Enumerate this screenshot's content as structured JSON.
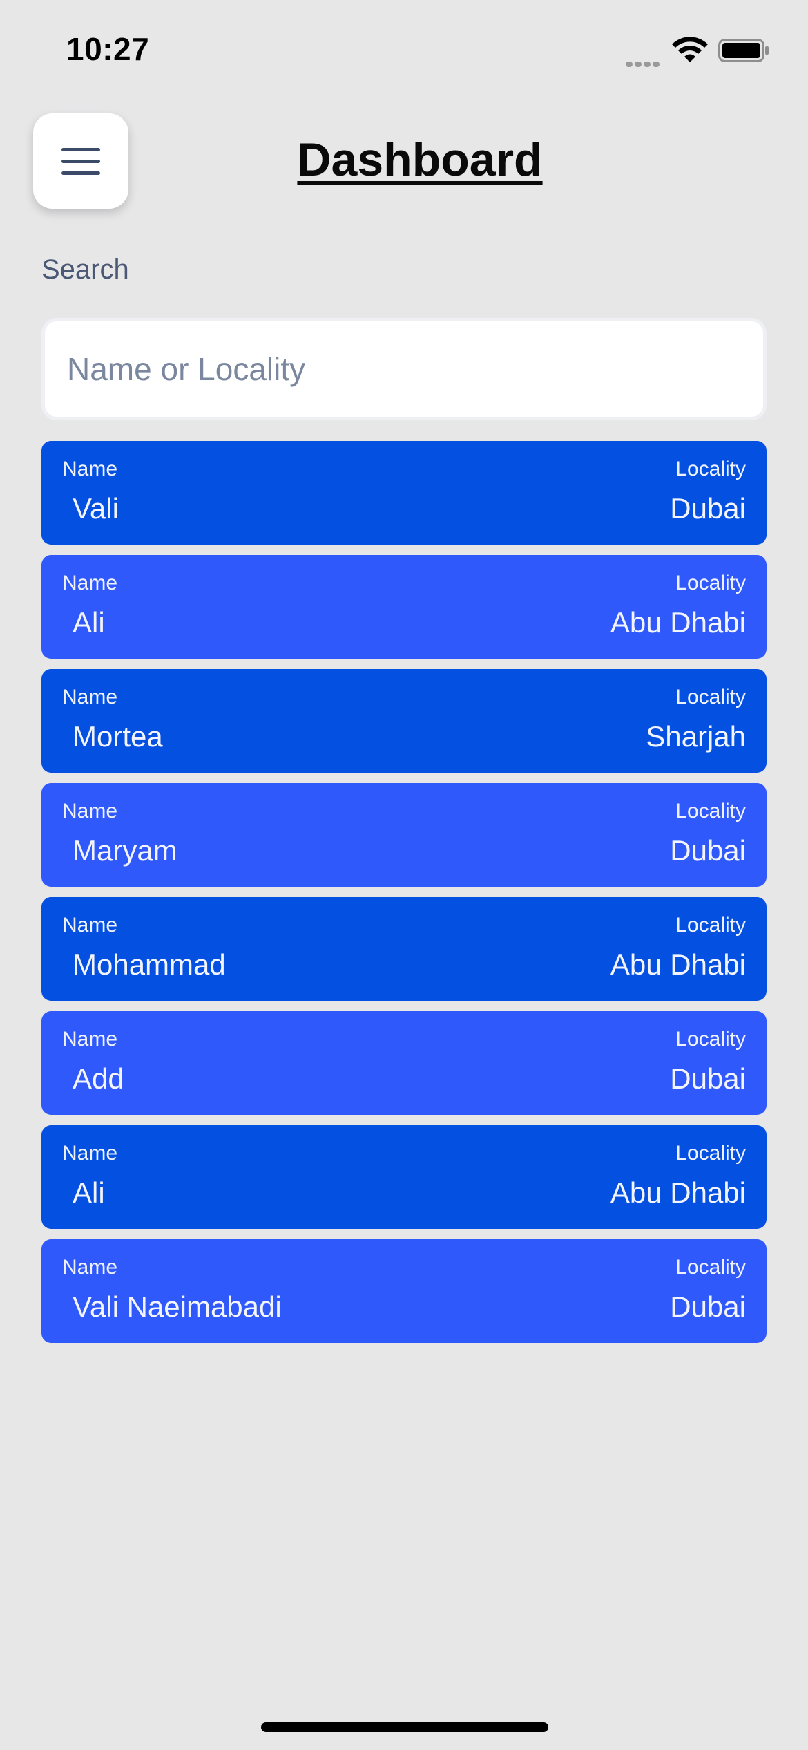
{
  "status_bar": {
    "time": "10:27"
  },
  "header": {
    "title": "Dashboard",
    "menu_icon": "hamburger-menu-icon"
  },
  "search": {
    "label": "Search",
    "placeholder": "Name or Locality",
    "value": ""
  },
  "list": {
    "name_label": "Name",
    "locality_label": "Locality",
    "items": [
      {
        "name": "Vali",
        "locality": "Dubai"
      },
      {
        "name": "Ali",
        "locality": "Abu Dhabi"
      },
      {
        "name": "Mortea",
        "locality": "Sharjah"
      },
      {
        "name": "Maryam",
        "locality": "Dubai"
      },
      {
        "name": "Mohammad",
        "locality": "Abu Dhabi"
      },
      {
        "name": "Add",
        "locality": "Dubai"
      },
      {
        "name": "Ali",
        "locality": "Abu Dhabi"
      },
      {
        "name": "Vali Naeimabadi",
        "locality": "Dubai"
      }
    ]
  },
  "colors": {
    "background": "#e7e7e8",
    "card_dark": "#0450e0",
    "card_light": "#3059fb",
    "title": "#0a0a0a",
    "label": "#4a5875"
  }
}
